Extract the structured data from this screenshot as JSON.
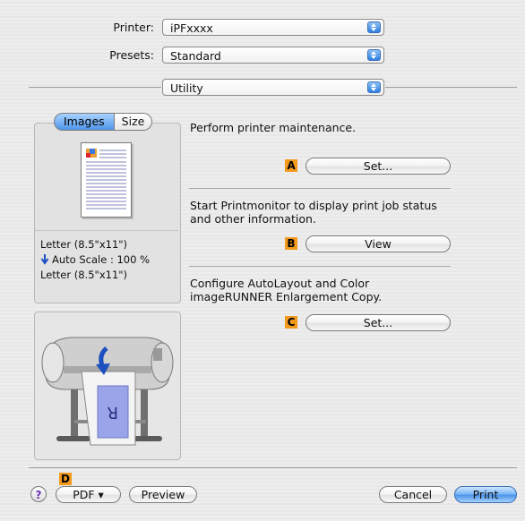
{
  "printer": {
    "label": "Printer:",
    "value": "iPFxxxx"
  },
  "presets": {
    "label": "Presets:",
    "value": "Standard"
  },
  "section": {
    "value": "Utility"
  },
  "preview_tabs": [
    {
      "label": "Images"
    },
    {
      "label": "Size"
    }
  ],
  "preview_info": {
    "paper": "Letter (8.5\"x11\")",
    "scale": "Auto Scale : 100 %",
    "output": "Letter (8.5\"x11\")"
  },
  "utility": [
    {
      "description": "Perform printer maintenance.",
      "badge": "A",
      "button": "Set..."
    },
    {
      "description": "Start Printmonitor to display print job status\nand other information.",
      "badge": "B",
      "button": "View"
    },
    {
      "description": "Configure AutoLayout and Color\nimageRUNNER Enlargement Copy.",
      "badge": "C",
      "button": "Set..."
    }
  ],
  "footer": {
    "help": "?",
    "pdf_badge": "D",
    "pdf": "PDF ▾",
    "preview": "Preview",
    "cancel": "Cancel",
    "print": "Print"
  },
  "colors": {
    "badge": "#f39a1c",
    "accent_blue": "#4e95ea"
  }
}
